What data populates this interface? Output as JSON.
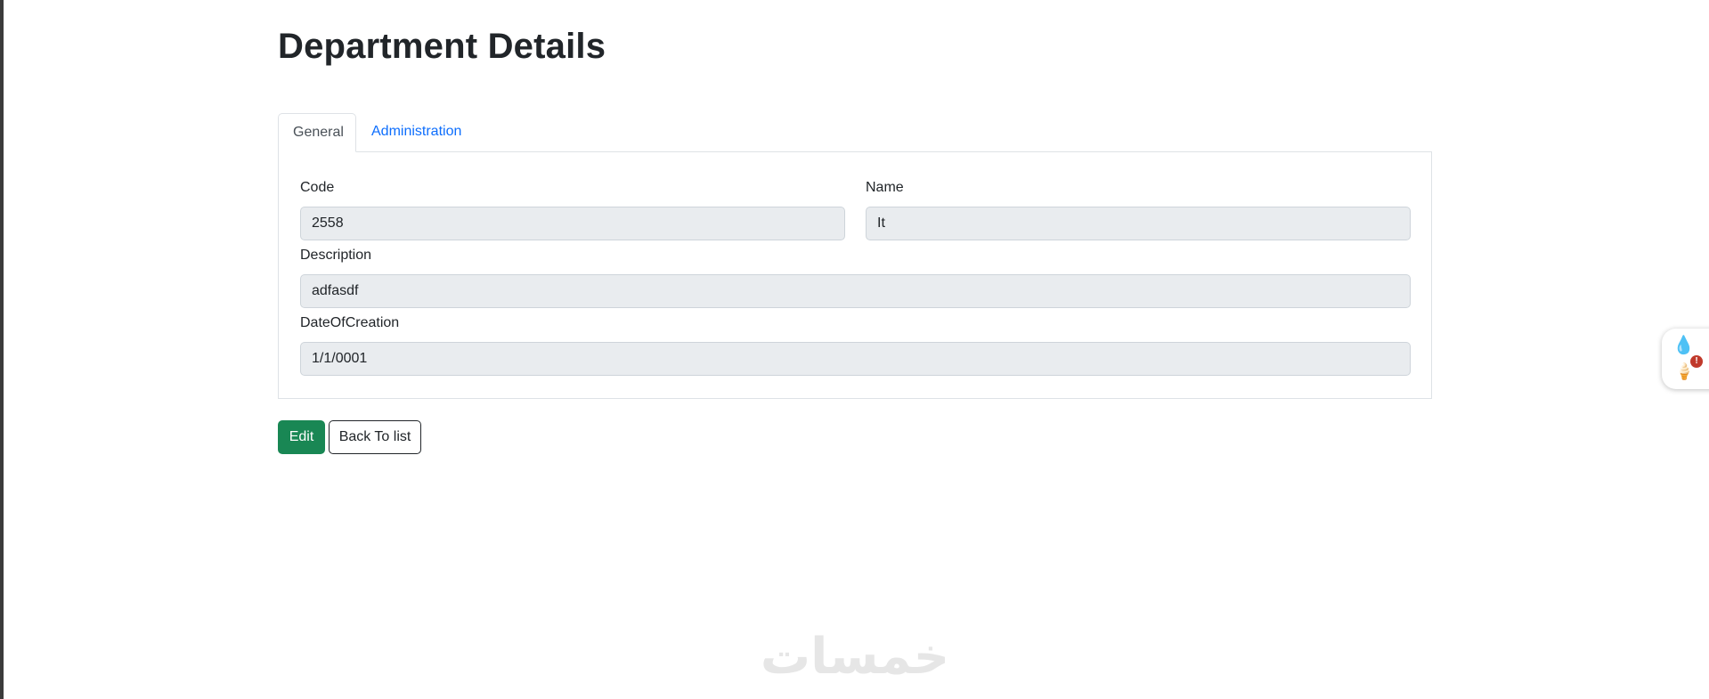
{
  "page": {
    "title": "Department Details"
  },
  "tabs": [
    {
      "label": "General",
      "active": true
    },
    {
      "label": "Administration",
      "active": false
    }
  ],
  "fields": {
    "code": {
      "label": "Code",
      "value": "2558"
    },
    "name": {
      "label": "Name",
      "value": "It"
    },
    "description": {
      "label": "Description",
      "value": "adfasdf"
    },
    "date_of_creation": {
      "label": "DateOfCreation",
      "value": "1/1/0001"
    }
  },
  "actions": {
    "edit_label": "Edit",
    "back_label": "Back To list"
  },
  "side_widget": {
    "badge": "!",
    "icons": [
      "water-drop-icon",
      "ice-cream-icon"
    ]
  },
  "watermark": {
    "text": "خمسات"
  },
  "colors": {
    "accent_link": "#0d6efd",
    "edit_button": "#198754",
    "input_readonly_bg": "#e9ecef"
  }
}
